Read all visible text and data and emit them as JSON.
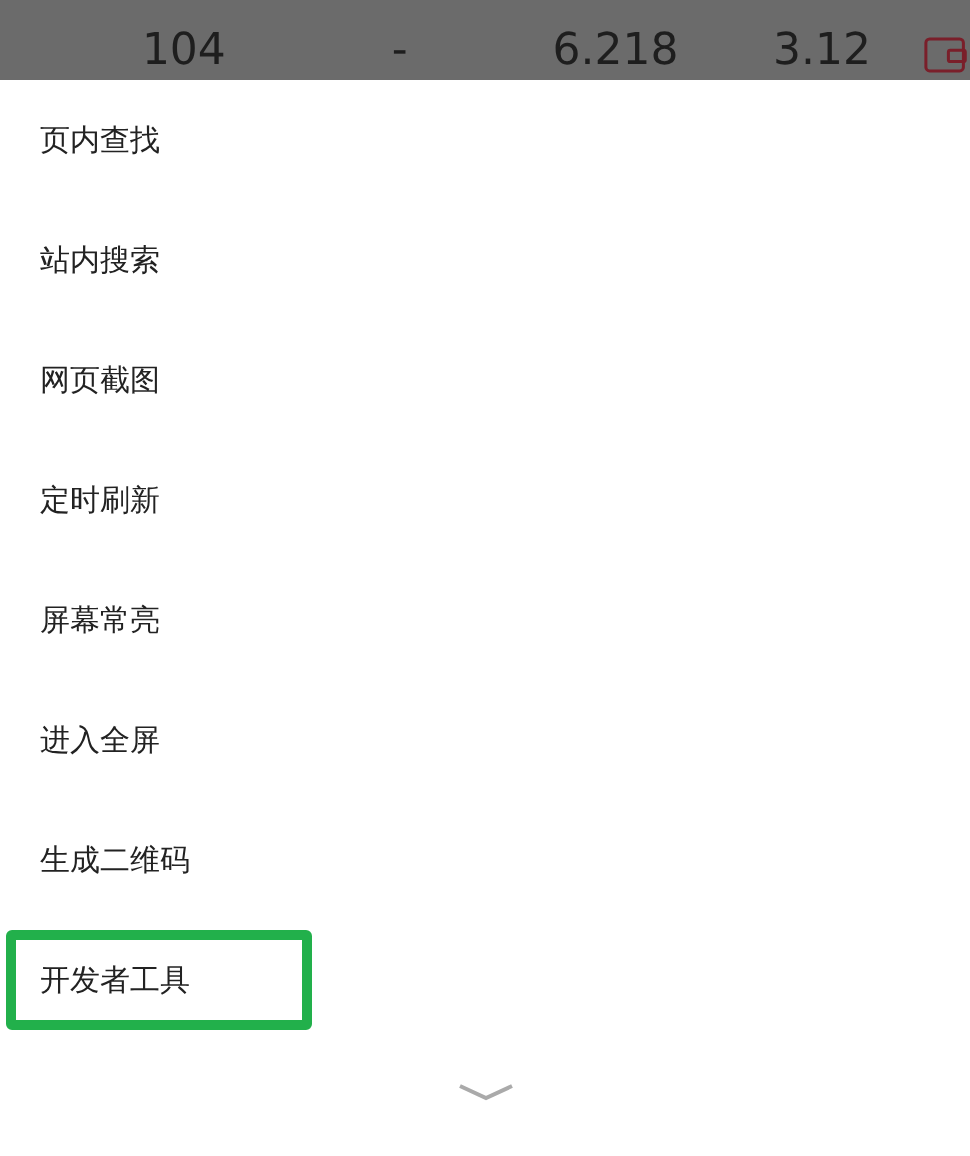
{
  "background_row": [
    "104",
    "-",
    "6.218",
    "3.12"
  ],
  "menu": {
    "items": [
      {
        "label": "页内查找",
        "highlighted": false
      },
      {
        "label": "站内搜索",
        "highlighted": false
      },
      {
        "label": "网页截图",
        "highlighted": false
      },
      {
        "label": "定时刷新",
        "highlighted": false
      },
      {
        "label": "屏幕常亮",
        "highlighted": false
      },
      {
        "label": "进入全屏",
        "highlighted": false
      },
      {
        "label": "生成二维码",
        "highlighted": false
      },
      {
        "label": "开发者工具",
        "highlighted": true
      }
    ]
  }
}
